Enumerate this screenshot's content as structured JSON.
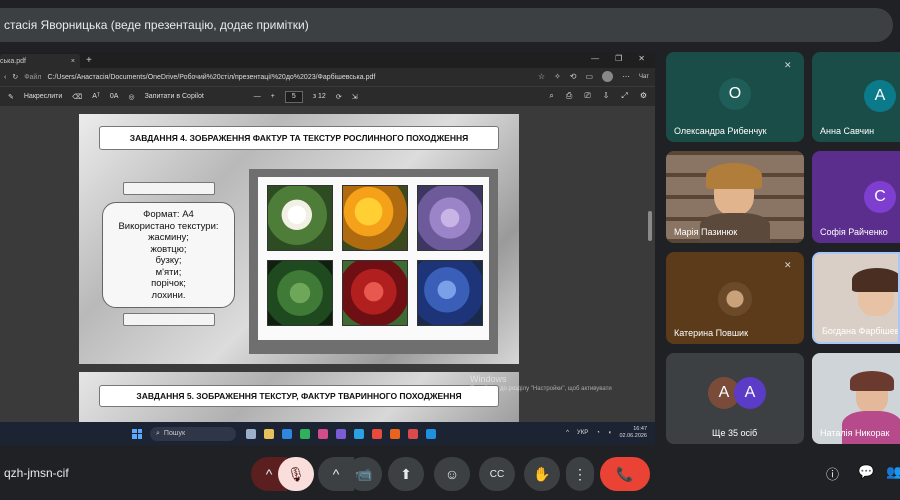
{
  "banner": {
    "text": "стасія Яворницька (веде презентацію, додає примітки)"
  },
  "browser": {
    "tab_title": "ська.pdf",
    "tab_close": "×",
    "tab_new": "+",
    "window_controls": [
      "—",
      "❐",
      "✕"
    ],
    "url_label": "Файл",
    "url": "C:/Users/Анастасія/Documents/OneDrive/Робочий%20стіл/презентації%20до%2023/Фарбішевська.pdf",
    "copilot_label": "Чат"
  },
  "pdf_toolbar": {
    "draw_label": "Накреслити",
    "text_label": "Aᵀ",
    "read_label": "0A",
    "copilot": "Запитати в Copilot",
    "minus": "—",
    "plus": "+",
    "page_current": "5",
    "page_total": "з 12"
  },
  "slide4": {
    "title": "ЗАВДАННЯ 4. ЗОБРАЖЕННЯ ФАКТУР ТА ТЕКСТУР РОСЛИННОГО ПОХОДЖЕННЯ",
    "info_lines": [
      "Формат: А4",
      "Використано текстури:",
      "жасмину;",
      "жовтцю;",
      "бузку;",
      "м'яти;",
      "порічок;",
      "лохини."
    ]
  },
  "slide5": {
    "title": "ЗАВДАННЯ 5. ЗОБРАЖЕННЯ ТЕКСТУР, ФАКТУР ТВАРИННОГО ПОХОДЖЕННЯ"
  },
  "watermark": {
    "line1": "Windows",
    "line2": "Перейдіть до розділу \"Настройки\", щоб активувати"
  },
  "taskbar": {
    "search": "Пошук",
    "lang": "УКР",
    "time": "16:47",
    "date": "02.06.2026"
  },
  "participants": [
    {
      "name": "Олександра Рибенчук",
      "initial": "О",
      "avatar_color": "#1b4d48"
    },
    {
      "name": "Анна Савчин",
      "initial": "А",
      "avatar_color": "#0b7a8a"
    },
    {
      "name": "Марія Пазинюк"
    },
    {
      "name": "Софія Райченко",
      "initial": "С",
      "avatar_color": "#7e3fd1"
    },
    {
      "name": "Катерина Повшик"
    },
    {
      "name": "Богдана Фарбішевська"
    },
    {
      "name": "Ще 35 осіб",
      "initials": [
        "А",
        "А"
      ]
    },
    {
      "name": "Наталія Никорак"
    }
  ],
  "meeting": {
    "code": "qzh-jmsn-cif"
  },
  "controls": {
    "caret": "^",
    "mic_off": "🎙",
    "camera": "📹",
    "present": "⬆",
    "emoji": "☺",
    "captions": "CC",
    "hand": "✋",
    "more": "⋮",
    "leave": "📞",
    "info": "ⓘ",
    "chat": "💬",
    "people": "👥"
  },
  "colors": {
    "accent": "#a8c7fa",
    "leave": "#ea4335",
    "tile_green": "#1b4d48",
    "tile_purple": "#5b2d8c"
  }
}
